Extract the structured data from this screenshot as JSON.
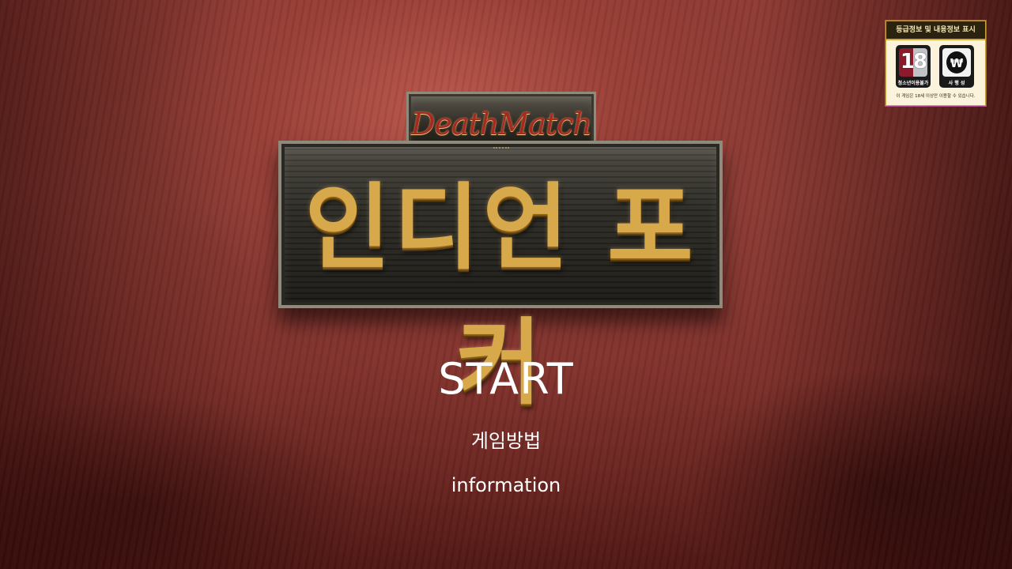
{
  "logo": {
    "subtitle": "DeathMatch",
    "title": "인디언 포커"
  },
  "menu": {
    "start": "START",
    "how_to_play": "게임방법",
    "information": "information"
  },
  "rating_badge": {
    "title": "등급정보 및 내용정보 표시",
    "age_number": "18",
    "age_label": "청소년이용불가",
    "gambling_icon": "won-sign-icon",
    "gambling_symbol": "₩",
    "gambling_label": "사 행 성",
    "note": "이 게임은 18세 이상만 이용할 수 있습니다."
  },
  "colors": {
    "background": "#8a3a33",
    "logo_gold": "#d7a94a",
    "logo_red": "#a52a22",
    "menu_text": "#ffffff"
  }
}
